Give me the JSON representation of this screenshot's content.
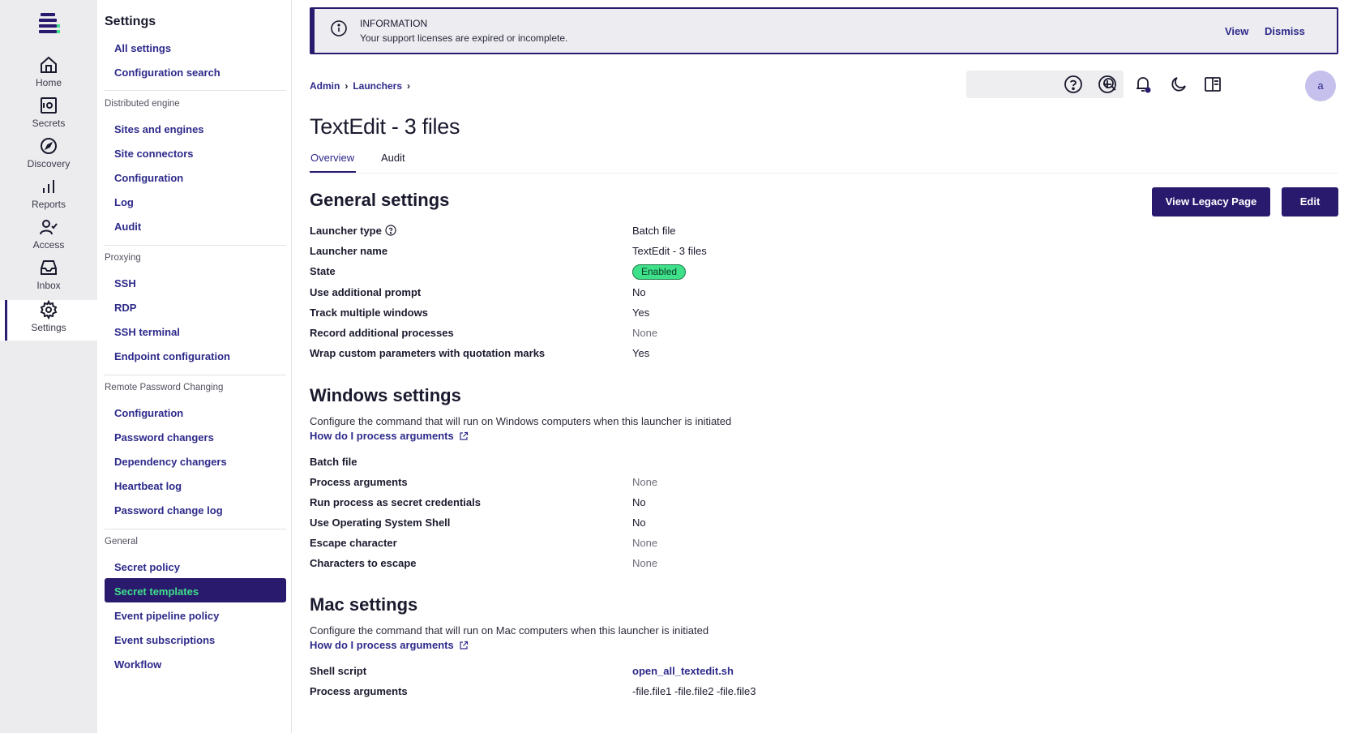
{
  "rail": {
    "items": [
      {
        "label": "Home"
      },
      {
        "label": "Secrets"
      },
      {
        "label": "Discovery"
      },
      {
        "label": "Reports"
      },
      {
        "label": "Access"
      },
      {
        "label": "Inbox"
      },
      {
        "label": "Settings"
      }
    ]
  },
  "sidenav": {
    "title": "Settings",
    "top_links": [
      "All settings",
      "Configuration search"
    ],
    "sections": [
      {
        "title": "Distributed engine",
        "items": [
          "Sites and engines",
          "Site connectors",
          "Configuration",
          "Log",
          "Audit"
        ]
      },
      {
        "title": "Proxying",
        "items": [
          "SSH",
          "RDP",
          "SSH terminal",
          "Endpoint configuration"
        ]
      },
      {
        "title": "Remote Password Changing",
        "items": [
          "Configuration",
          "Password changers",
          "Dependency changers",
          "Heartbeat log",
          "Password change log"
        ]
      },
      {
        "title": "General",
        "items": [
          "Secret policy",
          "Secret templates",
          "Event pipeline policy",
          "Event subscriptions",
          "Workflow"
        ]
      }
    ],
    "active_item": "Secret templates"
  },
  "banner": {
    "title": "INFORMATION",
    "text": "Your support licenses are expired or incomplete.",
    "view": "View",
    "dismiss": "Dismiss"
  },
  "breadcrumb": [
    "Admin",
    "Launchers"
  ],
  "search": {
    "placeholder": ""
  },
  "avatar": "a",
  "page": {
    "title": "TextEdit - 3 files",
    "tabs": [
      "Overview",
      "Audit"
    ],
    "active_tab": "Overview"
  },
  "buttons": {
    "legacy": "View Legacy Page",
    "edit": "Edit"
  },
  "general": {
    "heading": "General settings",
    "rows": [
      {
        "label": "Launcher type",
        "value": "Batch file"
      },
      {
        "label": "Launcher name",
        "value": "TextEdit - 3 files"
      },
      {
        "label": "State",
        "value": "Enabled"
      },
      {
        "label": "Use additional prompt",
        "value": "No"
      },
      {
        "label": "Track multiple windows",
        "value": "Yes"
      },
      {
        "label": "Record additional processes",
        "value": "None"
      },
      {
        "label": "Wrap custom parameters with quotation marks",
        "value": "Yes"
      }
    ]
  },
  "windows": {
    "heading": "Windows settings",
    "description": "Configure the command that will run on Windows computers when this launcher is initiated",
    "link": "How do I process arguments",
    "rows": [
      {
        "label": "Batch file",
        "value": ""
      },
      {
        "label": "Process arguments",
        "value": "None"
      },
      {
        "label": "Run process as secret credentials",
        "value": "No"
      },
      {
        "label": "Use Operating System Shell",
        "value": "No"
      },
      {
        "label": "Escape character",
        "value": "None"
      },
      {
        "label": "Characters to escape",
        "value": "None"
      }
    ]
  },
  "mac": {
    "heading": "Mac settings",
    "description": "Configure the command that will run on Mac computers when this launcher is initiated",
    "link": "How do I process arguments",
    "rows": [
      {
        "label": "Shell script",
        "value": "open_all_textedit.sh"
      },
      {
        "label": "Process arguments",
        "value": "-file.file1 -file.file2 -file.file3"
      }
    ]
  },
  "colors": {
    "brand": "#2a1a6e",
    "accent": "#3ee08a",
    "link": "#2d2a8a"
  }
}
